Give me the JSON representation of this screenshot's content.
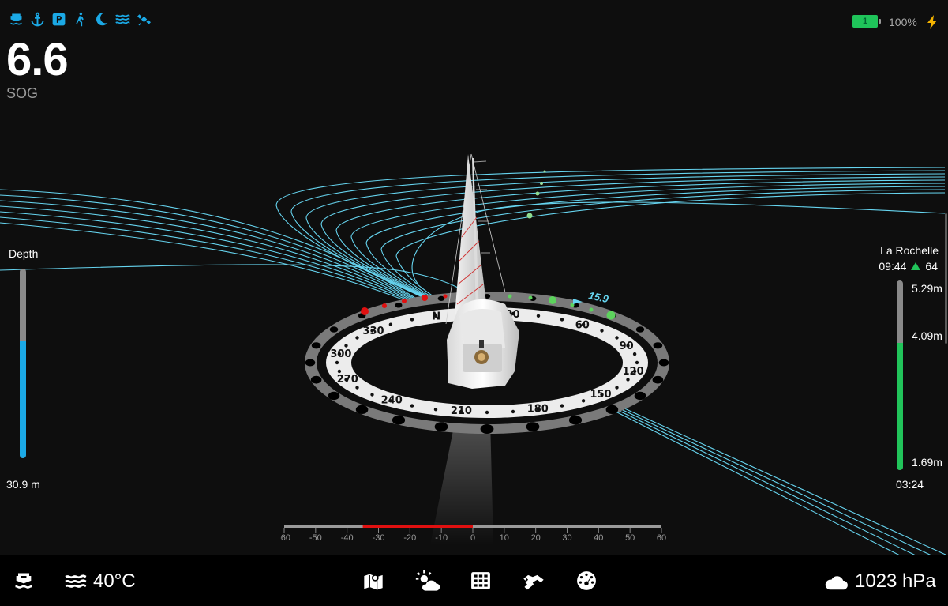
{
  "status_icons": [
    "boat-icon",
    "anchor-icon",
    "parking-icon",
    "person-overboard-icon",
    "moon-icon",
    "waves-icon",
    "satellite-icon"
  ],
  "colors": {
    "accent": "#1ba9e6",
    "tide": "#21c45a",
    "port": "#e01010",
    "starboard": "#5dd35d",
    "track": "#66d4ef"
  },
  "sog": {
    "value": "6.6",
    "label": "SOG"
  },
  "battery": {
    "level_label": "1",
    "percent": "100%",
    "level": 1.0,
    "charging": true
  },
  "depth": {
    "title": "Depth",
    "value": "30.9 m",
    "fill_fraction": 0.62
  },
  "tide": {
    "station": "La Rochelle",
    "next_time": "09:44",
    "next_height": "64",
    "labels": {
      "high": "5.29m",
      "current": "4.09m",
      "low": "1.69m"
    },
    "fill_fraction": 0.67,
    "time_bottom": "03:24"
  },
  "compass": {
    "labels": [
      "N",
      "30",
      "60",
      "90",
      "120",
      "150",
      "180",
      "210",
      "240",
      "270",
      "300",
      "330"
    ],
    "wind_readout": "15.9"
  },
  "heel_scale": {
    "ticks": [
      "-60",
      "-50",
      "-40",
      "-30",
      "-20",
      "-10",
      "0",
      "10",
      "20",
      "30",
      "40",
      "50",
      "60"
    ],
    "red_range": [
      -35,
      0
    ]
  },
  "bottom_bar": {
    "water_temp": "40°C",
    "pressure": "1023 hPa",
    "nav_icons": [
      "map-icon",
      "weather-icon",
      "grid-icon",
      "handshake-icon",
      "gauge-icon"
    ]
  }
}
